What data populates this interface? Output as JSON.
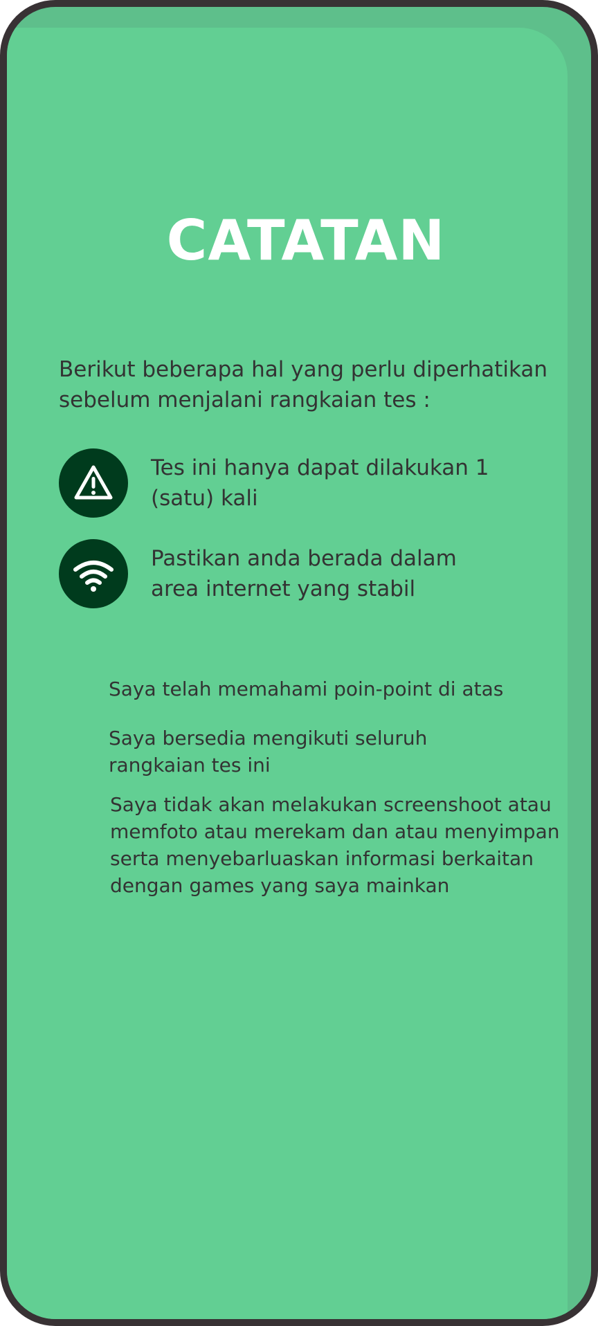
{
  "title": "CATATAN",
  "intro": "Berikut beberapa hal yang perlu diperhatikan sebelum menjalani rangkaian tes :",
  "notes": [
    {
      "icon": "warning-icon",
      "text": "Tes ini hanya dapat dilakukan 1 (satu) kali"
    },
    {
      "icon": "wifi-icon",
      "text": "Pastikan anda berada dalam area internet yang stabil"
    }
  ],
  "agreements": [
    "Saya telah memahami poin-point di atas",
    "Saya bersedia mengikuti seluruh rangkaian tes ini",
    "Saya tidak akan melakukan screenshoot atau memfoto atau merekam dan atau menyimpan serta menyebarluaskan informasi berkaitan dengan games yang saya mainkan"
  ],
  "colors": {
    "background": "#62cf93",
    "frame": "#383234",
    "icon_circle": "#003b1d",
    "title": "#ffffff",
    "text": "#333333"
  }
}
